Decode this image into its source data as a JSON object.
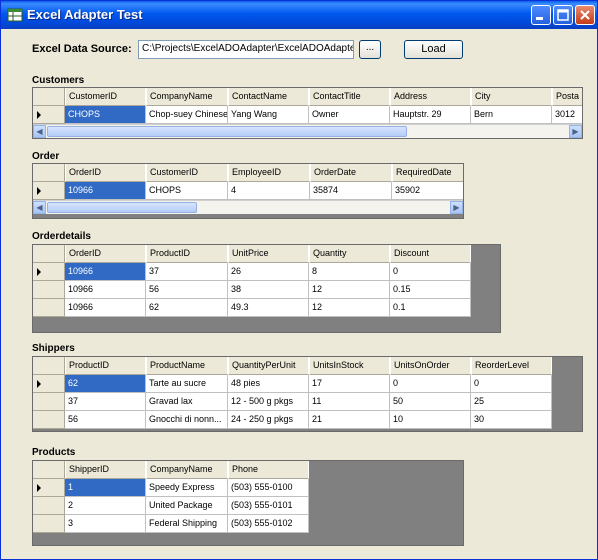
{
  "window": {
    "title": "Excel Adapter Test"
  },
  "datasource": {
    "label": "Excel Data Source:",
    "value": "C:\\Projects\\ExcelADOAdapter\\ExcelADOAdapter\\Pur",
    "browse_label": "...",
    "load_label": "Load"
  },
  "sections": {
    "customers": "Customers",
    "order": "Order",
    "orderdetails": "Orderdetails",
    "shippers": "Shippers",
    "products": "Products"
  },
  "customers": {
    "headers": [
      "CustomerID",
      "CompanyName",
      "ContactName",
      "ContactTitle",
      "Address",
      "City",
      "Posta"
    ],
    "rows": [
      [
        "CHOPS",
        "Chop-suey Chinese",
        "Yang Wang",
        "Owner",
        "Hauptstr. 29",
        "Bern",
        "3012"
      ]
    ]
  },
  "order": {
    "headers": [
      "OrderID",
      "CustomerID",
      "EmployeeID",
      "OrderDate",
      "RequiredDate"
    ],
    "rows": [
      [
        "10966",
        "CHOPS",
        "4",
        "35874",
        "35902"
      ]
    ]
  },
  "orderdetails": {
    "headers": [
      "OrderID",
      "ProductID",
      "UnitPrice",
      "Quantity",
      "Discount"
    ],
    "rows": [
      [
        "10966",
        "37",
        "26",
        "8",
        "0"
      ],
      [
        "10966",
        "56",
        "38",
        "12",
        "0.15"
      ],
      [
        "10966",
        "62",
        "49.3",
        "12",
        "0.1"
      ]
    ]
  },
  "shippers": {
    "headers": [
      "ProductID",
      "ProductName",
      "QuantityPerUnit",
      "UnitsInStock",
      "UnitsOnOrder",
      "ReorderLevel"
    ],
    "rows": [
      [
        "62",
        "Tarte au sucre",
        "48 pies",
        "17",
        "0",
        "0"
      ],
      [
        "37",
        "Gravad lax",
        "12 - 500 g pkgs",
        "11",
        "50",
        "25"
      ],
      [
        "56",
        "Gnocchi di nonn...",
        "24 - 250 g pkgs",
        "21",
        "10",
        "30"
      ]
    ]
  },
  "products": {
    "headers": [
      "ShipperID",
      "CompanyName",
      "Phone"
    ],
    "rows": [
      [
        "1",
        "Speedy Express",
        "(503) 555-0100"
      ],
      [
        "2",
        "United Package",
        "(503) 555-0101"
      ],
      [
        "3",
        "Federal Shipping",
        "(503) 555-0102"
      ]
    ]
  },
  "icons": {
    "app": "excel-app-icon",
    "minimize": "minimize-icon",
    "maximize": "maximize-icon",
    "close": "close-icon",
    "current_row": "current-row-arrow-icon",
    "scroll_left": "scroll-left-arrow-icon",
    "scroll_right": "scroll-right-arrow-icon"
  },
  "colors": {
    "titlebar": "#0054e3",
    "selection": "#316ac5",
    "grid_background": "#808080"
  }
}
